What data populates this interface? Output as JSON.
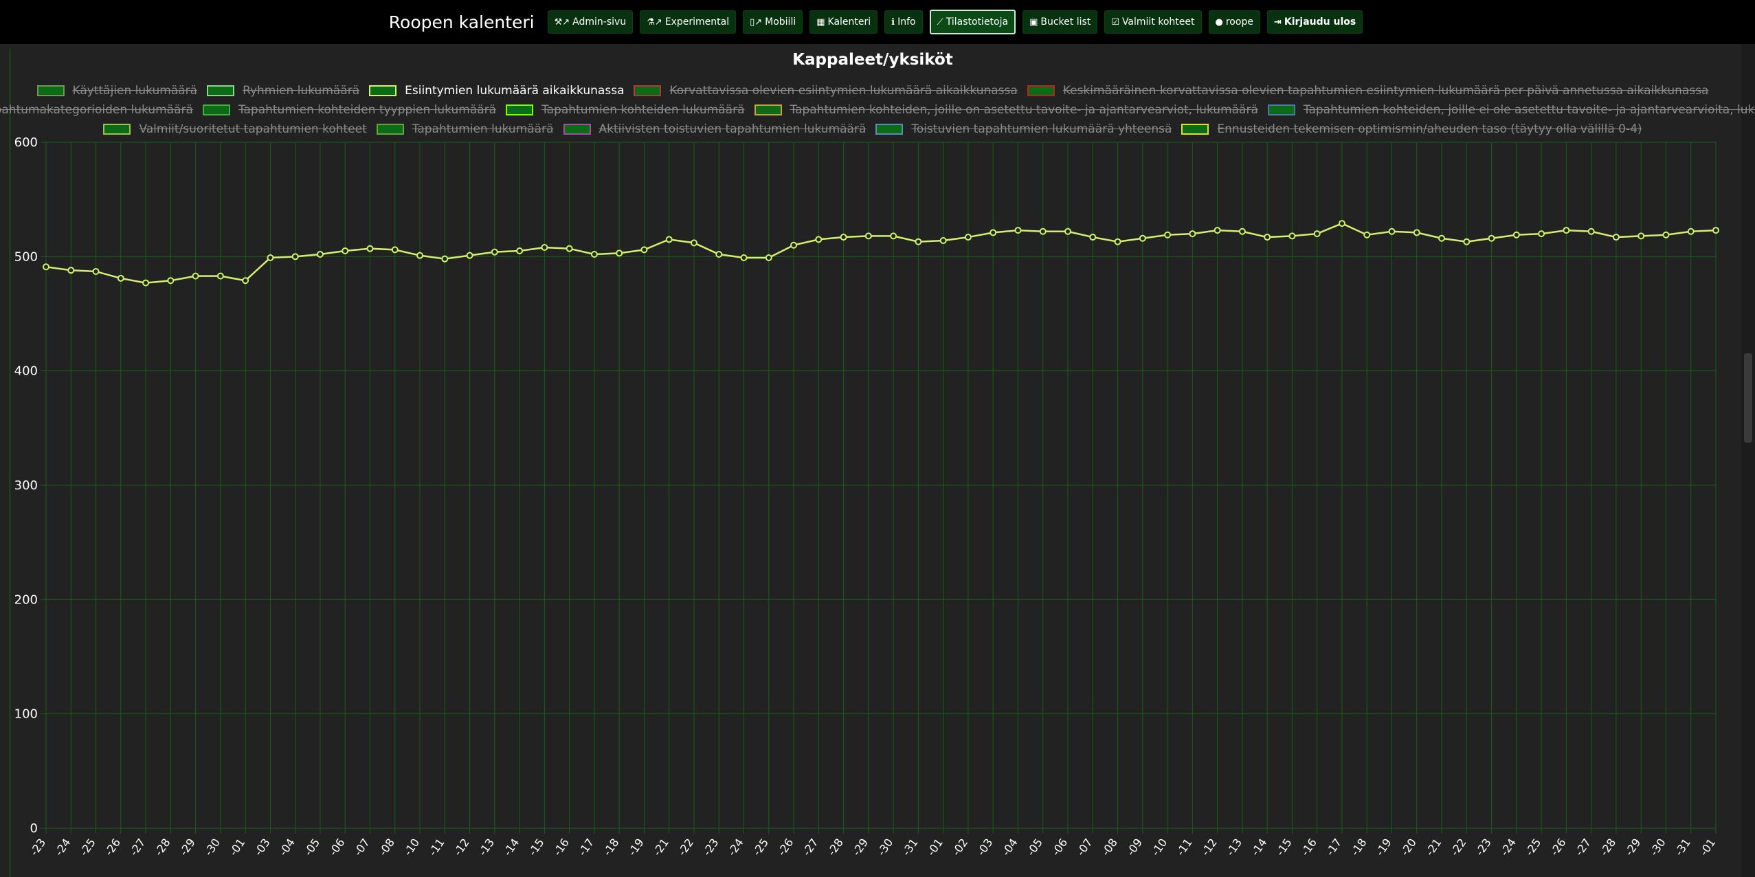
{
  "nav": {
    "brand": "Roopen kalenteri",
    "items": [
      {
        "label": "Admin-sivu",
        "icon": "tools-external-icon",
        "glyph": "⚒↗"
      },
      {
        "label": "Experimental",
        "icon": "flask-external-icon",
        "glyph": "⚗↗"
      },
      {
        "label": "Mobiili",
        "icon": "mobile-external-icon",
        "glyph": "▯↗"
      },
      {
        "label": "Kalenteri",
        "icon": "calendar-icon",
        "glyph": "▦"
      },
      {
        "label": "Info",
        "icon": "info-icon",
        "glyph": "ℹ"
      },
      {
        "label": "Tilastotietoja",
        "icon": "chart-line-icon",
        "glyph": "⟋"
      },
      {
        "label": "Bucket list",
        "icon": "lock-icon",
        "glyph": "▣"
      },
      {
        "label": "Valmiit kohteet",
        "icon": "check-square-icon",
        "glyph": "☑"
      },
      {
        "label": "roope",
        "icon": "user-icon",
        "glyph": "●"
      },
      {
        "label": "Kirjaudu ulos",
        "icon": "sign-out-icon",
        "glyph": "⇥"
      }
    ]
  },
  "chart_data": {
    "type": "line",
    "title": "Kappaleet/yksiköt",
    "ylim": [
      0,
      600
    ],
    "yticks": [
      0,
      100,
      200,
      300,
      400,
      500,
      600
    ],
    "grid": true,
    "legend_position": "top",
    "x": [
      "-23",
      "-24",
      "-25",
      "-26",
      "-27",
      "-28",
      "-29",
      "-30",
      "-01",
      "-03",
      "-04",
      "-05",
      "-06",
      "-07",
      "-08",
      "-10",
      "-11",
      "-12",
      "-13",
      "-14",
      "-15",
      "-16",
      "-17",
      "-18",
      "-19",
      "-21",
      "-22",
      "-23",
      "-24",
      "-25",
      "-26",
      "-27",
      "-28",
      "-29",
      "-30",
      "-31",
      "-01",
      "-02",
      "-03",
      "-04",
      "-05",
      "-06",
      "-07",
      "-08",
      "-09",
      "-10",
      "-11",
      "-12",
      "-13",
      "-14",
      "-15",
      "-16",
      "-17",
      "-18",
      "-19",
      "-20",
      "-21",
      "-22",
      "-23",
      "-24",
      "-25",
      "-26",
      "-27",
      "-28",
      "-29",
      "-30",
      "-31",
      "-01"
    ],
    "series": [
      {
        "name": "Esiintymien lukumäärä aikaikkunassa",
        "color": "#d4f06f",
        "values": [
          491,
          488,
          487,
          481,
          477,
          479,
          483,
          483,
          479,
          499,
          500,
          502,
          505,
          507,
          506,
          501,
          498,
          501,
          504,
          505,
          508,
          507,
          502,
          503,
          506,
          515,
          512,
          502,
          499,
          499,
          510,
          515,
          517,
          518,
          518,
          513,
          514,
          517,
          521,
          523,
          522,
          522,
          517,
          513,
          516,
          519,
          520,
          523,
          522,
          517,
          518,
          520,
          529,
          519,
          522,
          521,
          516,
          513,
          516,
          519,
          520,
          523,
          522,
          517,
          518,
          519,
          522,
          523
        ]
      }
    ],
    "legend": [
      {
        "label": "Käyttäjien lukumäärä",
        "fill": "#0b6b17",
        "border": "#6a9a4a",
        "hidden": true
      },
      {
        "label": "Ryhmien lukumäärä",
        "fill": "#0b6b17",
        "border": "#8fd08f",
        "hidden": true
      },
      {
        "label": "Esiintymien lukumäärä aikaikkunassa",
        "fill": "#0b6b17",
        "border": "#d4f06f",
        "hidden": false
      },
      {
        "label": "Korvattavissa olevien esiintymien lukumäärä aikaikkunassa",
        "fill": "#0b6b17",
        "border": "#b03a3a",
        "hidden": true
      },
      {
        "label": "Keskimääräinen korvattavissa olevien tapahtumien esiintymien lukumäärä per päivä annetussa aikaikkunassa",
        "fill": "#0b6b17",
        "border": "#c0201a",
        "hidden": true
      },
      {
        "label": "Tapahtumakategorioiden lukumäärä",
        "fill": "#0b6b17",
        "border": "#9acd32",
        "hidden": true
      },
      {
        "label": "Tapahtumien kohteiden tyyppien lukumäärä",
        "fill": "#0b6b17",
        "border": "#4aa84a",
        "hidden": true
      },
      {
        "label": "Tapahtumien kohteiden lukumäärä",
        "fill": "#0b6b17",
        "border": "#7cfc00",
        "hidden": true
      },
      {
        "label": "Tapahtumien kohteiden, joille on asetettu tavoite- ja ajantarvearviot, lukumäärä",
        "fill": "#0b6b17",
        "border": "#c8a040",
        "hidden": true
      },
      {
        "label": "Tapahtumien kohteiden, joille ei ole asetettu tavoite- ja ajantarvearvioita, lukumäärä",
        "fill": "#0b6b17",
        "border": "#4a7aa8",
        "hidden": true
      },
      {
        "label": "Valmiit/suoritetut tapahtumien kohteet",
        "fill": "#0b6b17",
        "border": "#a0c050",
        "hidden": true
      },
      {
        "label": "Tapahtumien lukumäärä",
        "fill": "#0b6b17",
        "border": "#6aa040",
        "hidden": true
      },
      {
        "label": "Aktiivisten toistuvien tapahtumien lukumäärä",
        "fill": "#0b6b17",
        "border": "#a050a0",
        "hidden": true
      },
      {
        "label": "Toistuvien tapahtumien lukumäärä yhteensä",
        "fill": "#0b6b17",
        "border": "#5a8ab8",
        "hidden": true
      },
      {
        "label": "Ennusteiden tekemisen optimismin/aheuden taso (täytyy olla välillä 0-4)",
        "fill": "#0b6b17",
        "border": "#e0e030",
        "hidden": true
      }
    ]
  }
}
